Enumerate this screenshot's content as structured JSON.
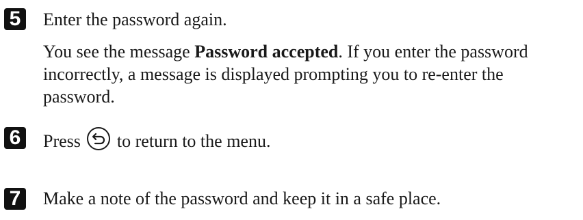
{
  "steps": [
    {
      "number": "5",
      "instruction": "Enter the password again.",
      "detail": {
        "before": "You see the message ",
        "bold": "Password accepted",
        "after": ". If you enter the password incorrectly, a message is displayed prompting you to re-enter the password."
      }
    },
    {
      "number": "6",
      "before_icon": "Press",
      "icon": "back-arrow-circle-icon",
      "after_icon": "to return to the menu."
    },
    {
      "number": "7",
      "instruction": "Make a note of the password and keep it in a safe place."
    }
  ]
}
